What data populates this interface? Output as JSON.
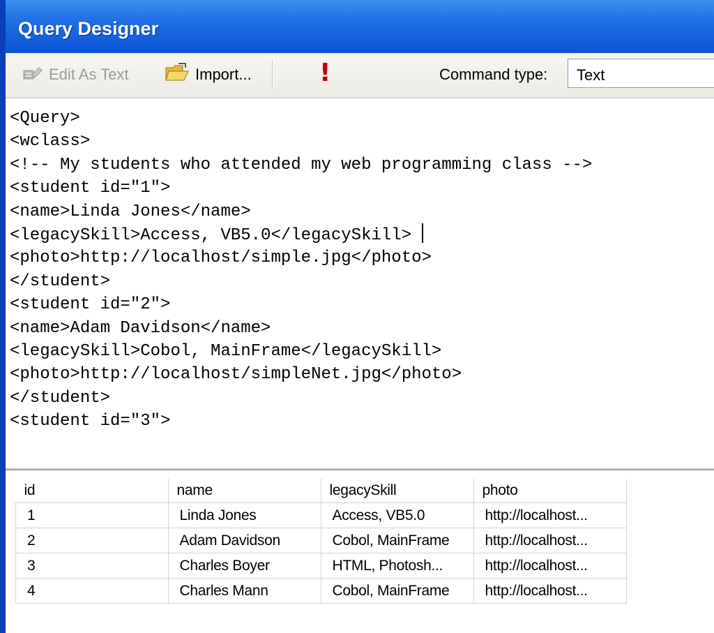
{
  "window": {
    "title": "Query Designer"
  },
  "toolbar": {
    "edit_as_text_label": "Edit As Text",
    "import_label": "Import...",
    "run_glyph": "!",
    "command_type_label": "Command type:",
    "command_type_value": "Text",
    "icons": {
      "edit_as_text": "edit-as-text-icon",
      "import": "open-folder-icon",
      "run": "exclamation-icon"
    }
  },
  "editor": {
    "lines": [
      "<Query>",
      "<wclass>",
      "<!-- My students who attended my web programming class -->",
      "<student id=\"1\">",
      "<name>Linda Jones</name>",
      "<legacySkill>Access, VB5.0</legacySkill> ",
      "<photo>http://localhost/simple.jpg</photo>",
      "</student>",
      "<student id=\"2\">",
      "<name>Adam Davidson</name>",
      "<legacySkill>Cobol, MainFrame</legacySkill>",
      "<photo>http://localhost/simpleNet.jpg</photo>",
      "</student>",
      "<student id=\"3\">"
    ]
  },
  "results": {
    "columns": [
      "id",
      "name",
      "legacySkill",
      "photo"
    ],
    "rows": [
      [
        "1",
        "Linda Jones",
        "Access, VB5.0",
        "http://localhost..."
      ],
      [
        "2",
        "Adam Davidson",
        "Cobol, MainFrame",
        "http://localhost..."
      ],
      [
        "3",
        "Charles Boyer",
        "HTML, Photosh...",
        "http://localhost..."
      ],
      [
        "4",
        "Charles Mann",
        "Cobol, MainFrame",
        "http://localhost..."
      ]
    ]
  },
  "colors": {
    "title_bar": "#0b55d6",
    "window_border": "#0a3fb8",
    "run_icon": "#c0001a"
  }
}
